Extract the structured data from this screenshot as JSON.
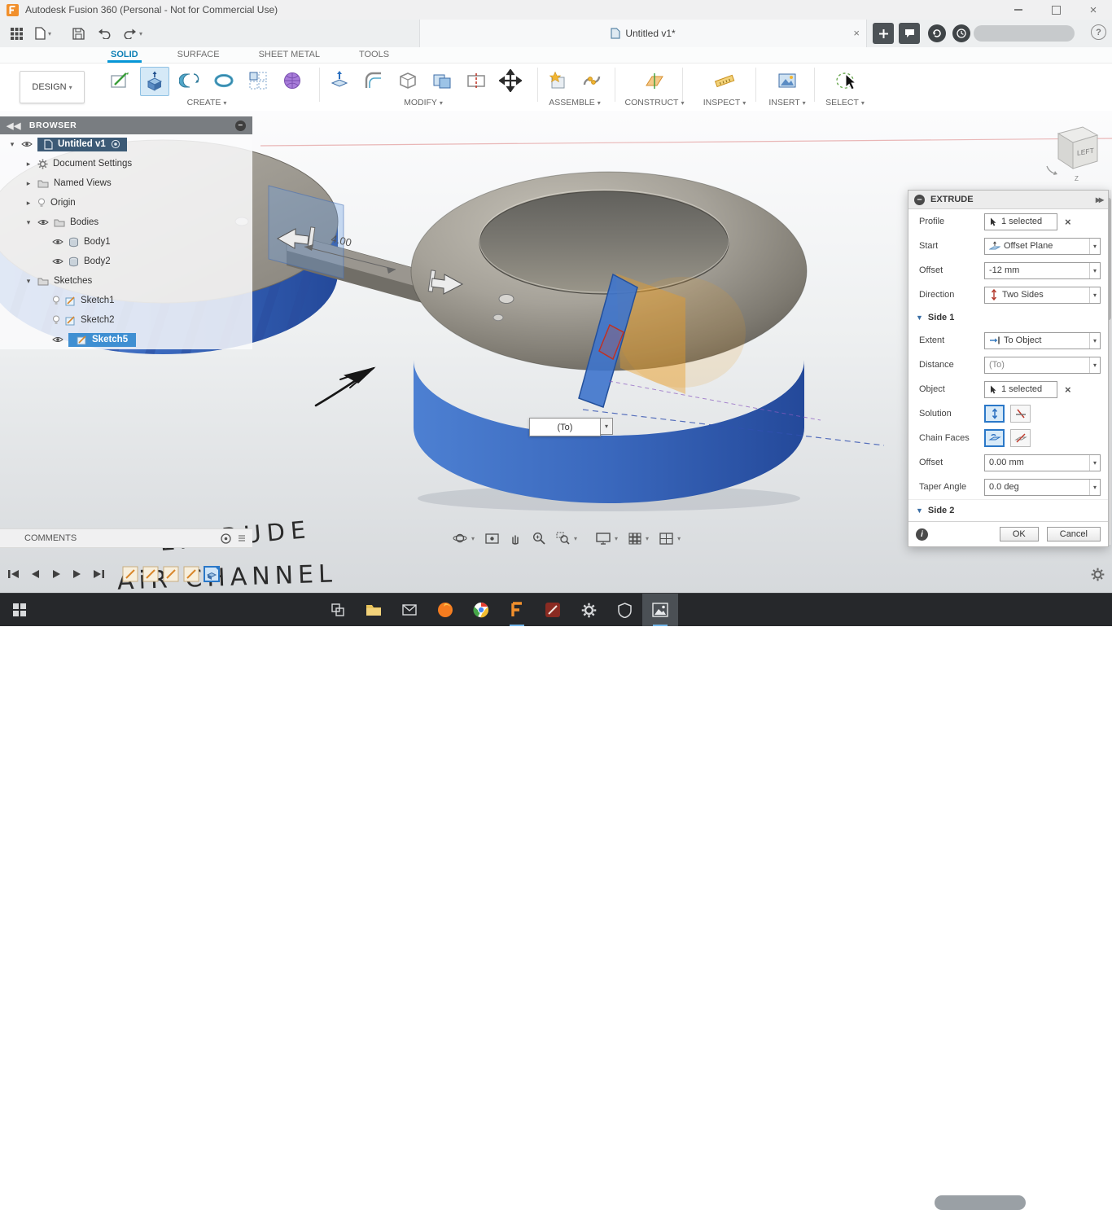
{
  "titlebar": {
    "title": "Autodesk Fusion 360 (Personal - Not for Commercial Use)"
  },
  "toolbar": {
    "tab_title": "Untitled v1*"
  },
  "ribbon": {
    "workspace": "DESIGN",
    "tabs": [
      {
        "label": "SOLID"
      },
      {
        "label": "SURFACE"
      },
      {
        "label": "SHEET METAL"
      },
      {
        "label": "TOOLS"
      }
    ],
    "groups": [
      {
        "label": "CREATE"
      },
      {
        "label": "MODIFY"
      },
      {
        "label": "ASSEMBLE"
      },
      {
        "label": "CONSTRUCT"
      },
      {
        "label": "INSPECT"
      },
      {
        "label": "INSERT"
      },
      {
        "label": "SELECT"
      }
    ]
  },
  "browser": {
    "title": "BROWSER",
    "tree": [
      {
        "label": "Untitled v1",
        "icon": "document-icon",
        "state": "selected"
      },
      {
        "label": "Document Settings",
        "icon": "gear-icon"
      },
      {
        "label": "Named Views",
        "icon": "folder-icon"
      },
      {
        "label": "Origin",
        "icon": "bulb-icon",
        "visibility": "hidden"
      },
      {
        "label": "Bodies",
        "icon": "folder-icon",
        "visibility": "visible"
      },
      {
        "label": "Body1",
        "icon": "body-icon",
        "visibility": "visible"
      },
      {
        "label": "Body2",
        "icon": "body-icon",
        "visibility": "visible"
      },
      {
        "label": "Sketches",
        "icon": "folder-icon"
      },
      {
        "label": "Sketch1",
        "icon": "sketch-icon",
        "visibility": "hidden"
      },
      {
        "label": "Sketch2",
        "icon": "sketch-icon",
        "visibility": "hidden"
      },
      {
        "label": "Sketch5",
        "icon": "sketch-icon",
        "state": "selected",
        "visibility": "visible"
      }
    ]
  },
  "canvas": {
    "dimension": "4.00",
    "to_chip": "(To)",
    "annotation_line1": "EXTRUDE",
    "annotation_line2": "AiR CHANNEL",
    "viewcube_face": "LEFT",
    "viewcube_axis": "Z"
  },
  "extrude": {
    "title": "EXTRUDE",
    "profile_label": "Profile",
    "profile_value": "1 selected",
    "start_label": "Start",
    "start_value": "Offset Plane",
    "offset1_label": "Offset",
    "offset1_value": "-12 mm",
    "direction_label": "Direction",
    "direction_value": "Two Sides",
    "side1_label": "Side 1",
    "extent_label": "Extent",
    "extent_value": "To Object",
    "distance_label": "Distance",
    "distance_value": "(To)",
    "object_label": "Object",
    "object_value": "1 selected",
    "solution_label": "Solution",
    "chain_label": "Chain Faces",
    "offset2_label": "Offset",
    "offset2_value": "0.00 mm",
    "taper_label": "Taper Angle",
    "taper_value": "0.0 deg",
    "side2_label": "Side 2",
    "ok": "OK",
    "cancel": "Cancel"
  },
  "comments": {
    "label": "COMMENTS"
  },
  "colors": {
    "accent": "#0696d7",
    "tree_selection": "#3f8fd2",
    "root_selection": "#3c5a76",
    "body_blue": "#3a68bd",
    "preview_orange": "#e89a26",
    "taskbar": "#26282b"
  }
}
